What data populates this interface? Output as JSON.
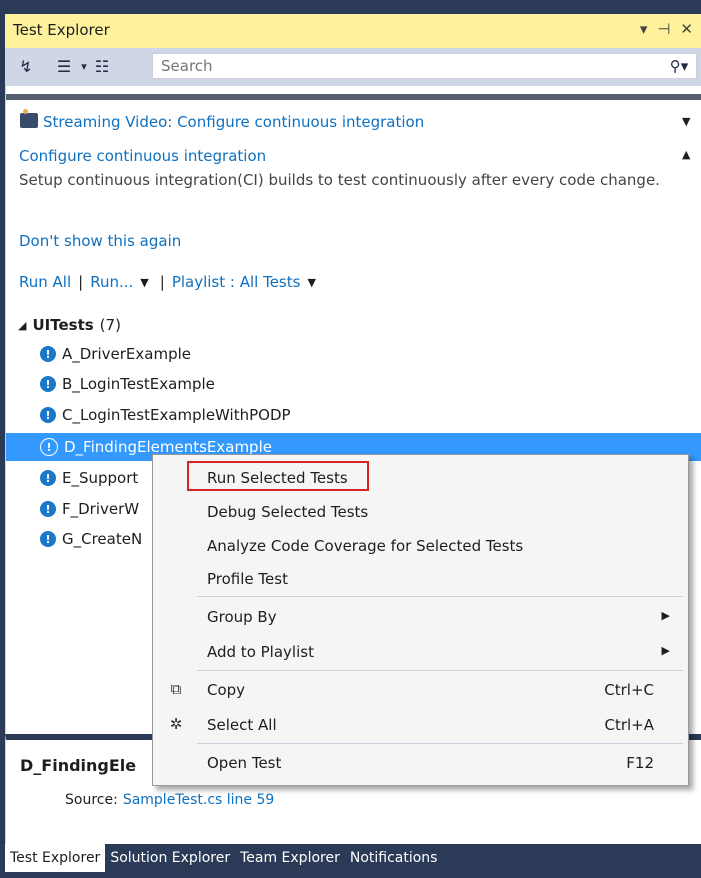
{
  "window": {
    "title": "Test Explorer",
    "controls": [
      "▾",
      "⊣",
      "✕"
    ]
  },
  "toolbar": {
    "search_placeholder": "Search"
  },
  "notification": {
    "video_link": "Streaming Video: Configure continuous integration",
    "ci_link": "Configure continuous integration",
    "ci_description": "Setup continuous integration(CI) builds to test continuously after every code change.",
    "dismiss_link": "Don't show this again"
  },
  "commands": {
    "run_all": "Run All",
    "run": "Run...",
    "playlist": "Playlist : All Tests"
  },
  "tree": {
    "group_name": "UITests",
    "group_count": "(7)",
    "tests": [
      "A_DriverExample",
      "B_LoginTestExample",
      "C_LoginTestExampleWithPODP",
      "D_FindingElementsExample",
      "E_Support",
      "F_DriverW",
      "G_CreateN"
    ]
  },
  "details": {
    "title": "D_FindingEle",
    "source_label": "Source:",
    "source_link": "SampleTest.cs line 59"
  },
  "tabs": [
    "Test Explorer",
    "Solution Explorer",
    "Team Explorer",
    "Notifications"
  ],
  "context_menu": {
    "items": [
      {
        "label": "Run Selected Tests"
      },
      {
        "label": "Debug Selected Tests"
      },
      {
        "label": "Analyze Code Coverage for Selected Tests"
      },
      {
        "label": "Profile Test"
      },
      {
        "label": "Group By"
      },
      {
        "label": "Add to Playlist"
      },
      {
        "label": "Copy",
        "shortcut": "Ctrl+C"
      },
      {
        "label": "Select All",
        "shortcut": "Ctrl+A"
      },
      {
        "label": "Open Test",
        "shortcut": "F12"
      }
    ]
  },
  "colors": {
    "title_bar": "#fff29d",
    "toolbar": "#cfd6e5",
    "selection": "#3399ff",
    "link": "#0e70c0",
    "highlight_box": "#d92323",
    "frame": "#2b3a57"
  }
}
